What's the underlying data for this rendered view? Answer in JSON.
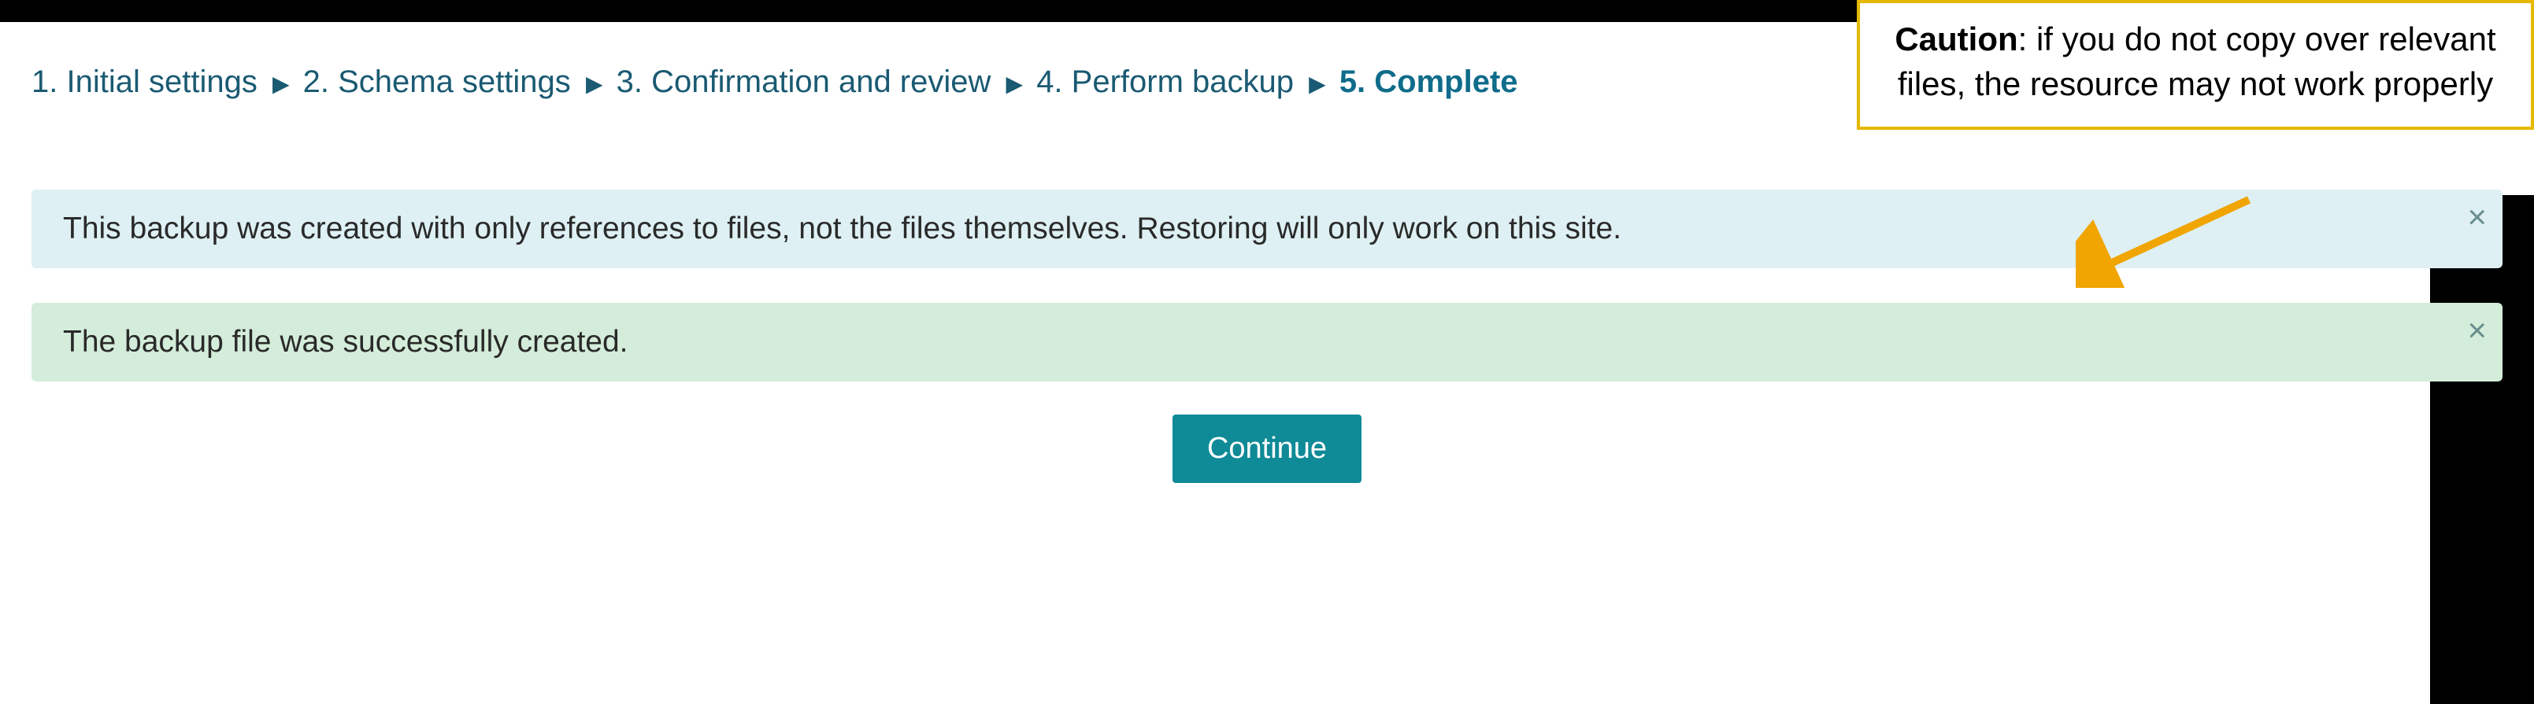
{
  "breadcrumb": {
    "steps": [
      {
        "label": "1. Initial settings"
      },
      {
        "label": "2. Schema settings"
      },
      {
        "label": "3. Confirmation and review"
      },
      {
        "label": "4. Perform backup"
      },
      {
        "label": "5. Complete",
        "active": true
      }
    ]
  },
  "alerts": {
    "info": {
      "text": "This backup was created with only references to files, not the files themselves. Restoring will only work on this site.",
      "close": "×"
    },
    "success": {
      "text": "The backup file was successfully created.",
      "close": "×"
    }
  },
  "buttons": {
    "continue": "Continue"
  },
  "callout": {
    "prefix": "Caution",
    "body": ": if you do not copy over relevant files, the resource may not work properly"
  }
}
